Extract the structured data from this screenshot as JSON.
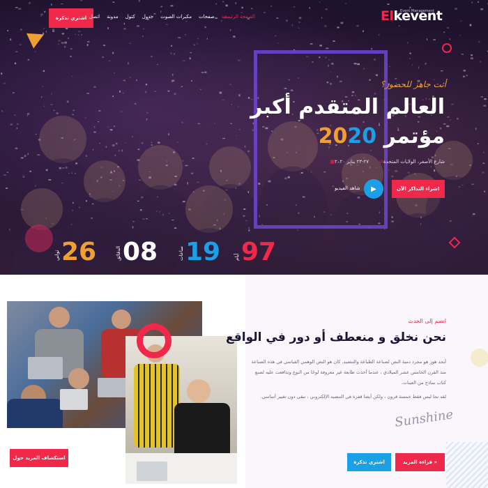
{
  "header": {
    "cta_label": "اشتري تذكرة",
    "logo_prefix": "El",
    "logo_suffix": "kevent",
    "logo_sub": "Event Management",
    "nav": [
      "الصفحة الرئيسية",
      "صفحات",
      "مكبرات الصوت",
      "جدول",
      "كتول",
      "مدونة",
      "اتصل"
    ]
  },
  "hero": {
    "kicker": "أنت جاهز للحضور؟",
    "title_line1_a": "العالم المتقدم ",
    "title_line1_hl": "أكبر",
    "title_line2_a": "مؤتمر ",
    "title_line2_year_a": "20",
    "title_line2_year_b": "20",
    "venue": "شارع الأصغر، الولايات المتحدة",
    "date": "٢٧-٢٣ يناير ٢٠٢٠",
    "buy_label": "شراء التذاكر الآن!",
    "watch_label": "شاهد الفيديو",
    "counters": [
      {
        "value": "97",
        "label": "أيام",
        "color": "#f0284a"
      },
      {
        "value": "19",
        "label": "ساعات",
        "color": "#1ba0e8"
      },
      {
        "value": "08",
        "label": "الدقائق",
        "color": "#ffffff"
      },
      {
        "value": "26",
        "label": "ثواني",
        "color": "#f0a030"
      }
    ]
  },
  "about": {
    "join_label": "انضم إلى الحدث",
    "title_a": "نحن نخلق و ",
    "title_u1": "منعطف",
    "title_b": " أو ",
    "title_u2": "دور",
    "title_c": " في الواقع",
    "para1": "أبجد هوز هو مجرد دمية النص لصناعة الطباعة والتنضيد. كان هو النص الوهمي القياسي في هذه الصناعة منذ القرن الخامس عشر الميلادي ، عندما أخذت طابعة غير معروفة لوحًا من النوع وتدافعت عليه لصنع كتاب نماذج من العينات.",
    "para2": "لقد نجا ليس فقط خمسة قرون ، ولكن أيضا قفزة في التنضيد الإلكتروني ، تبقى دون تغيير أساسي.",
    "signature": "Sunshine",
    "read_more_label": "قراءة المزيد »",
    "ticket_label": "اشتري تذكرة",
    "discover_label": "استكشاف المزيد حول"
  },
  "colors": {
    "accent": "#f0284a",
    "blue": "#1ba0e8",
    "orange": "#f0a030"
  }
}
